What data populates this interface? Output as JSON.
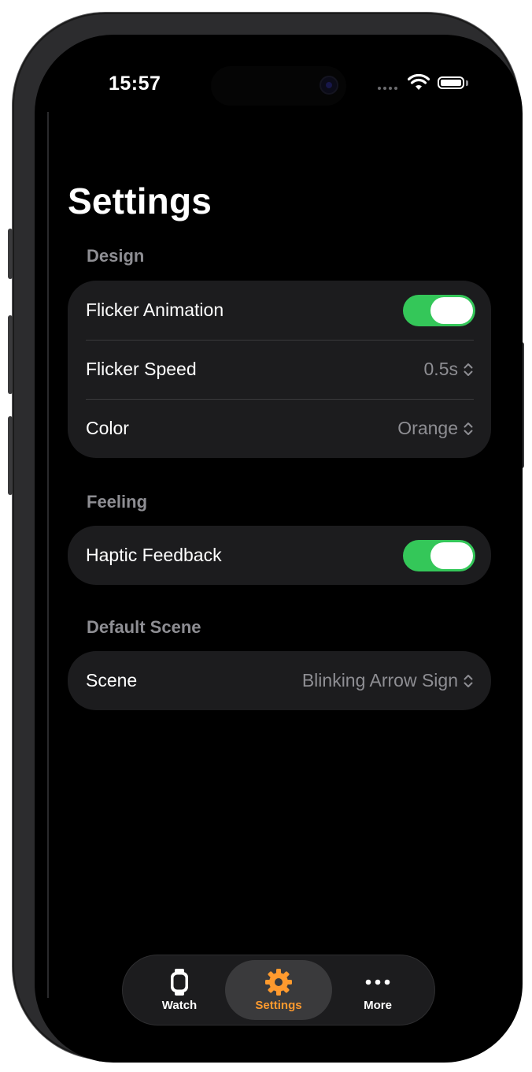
{
  "status_bar": {
    "time": "15:57"
  },
  "page": {
    "title": "Settings"
  },
  "sections": {
    "design": {
      "header": "Design",
      "flicker_animation": {
        "label": "Flicker Animation",
        "enabled": true
      },
      "flicker_speed": {
        "label": "Flicker Speed",
        "value": "0.5s"
      },
      "color": {
        "label": "Color",
        "value": "Orange"
      }
    },
    "feeling": {
      "header": "Feeling",
      "haptic_feedback": {
        "label": "Haptic Feedback",
        "enabled": true
      }
    },
    "default_scene": {
      "header": "Default Scene",
      "scene": {
        "label": "Scene",
        "value": "Blinking Arrow Sign"
      }
    }
  },
  "tabbar": {
    "watch": {
      "label": "Watch",
      "icon": "apple-watch-icon"
    },
    "settings": {
      "label": "Settings",
      "icon": "gear-icon",
      "active": true
    },
    "more": {
      "label": "More",
      "icon": "ellipsis-icon"
    }
  },
  "colors": {
    "background": "#000000",
    "group_background": "#1c1c1e",
    "toggle_on": "#34c759",
    "accent_active_tab": "#ff9a2e",
    "secondary_text": "#8e8e93"
  }
}
